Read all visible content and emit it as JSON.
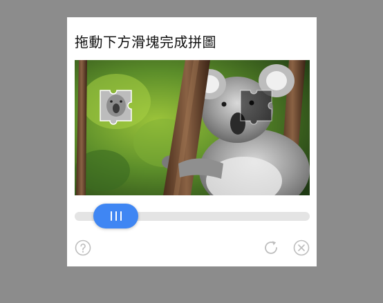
{
  "dialog": {
    "title": "拖動下方滑塊完成拼圖"
  },
  "slider": {
    "progress_fraction": 0.08
  },
  "icons": {
    "help": "help-circle-icon",
    "refresh": "refresh-icon",
    "close": "close-circle-icon"
  },
  "colors": {
    "accent": "#3f86f3",
    "track": "#e4e4e4",
    "backdrop": "#8c8c8c"
  }
}
